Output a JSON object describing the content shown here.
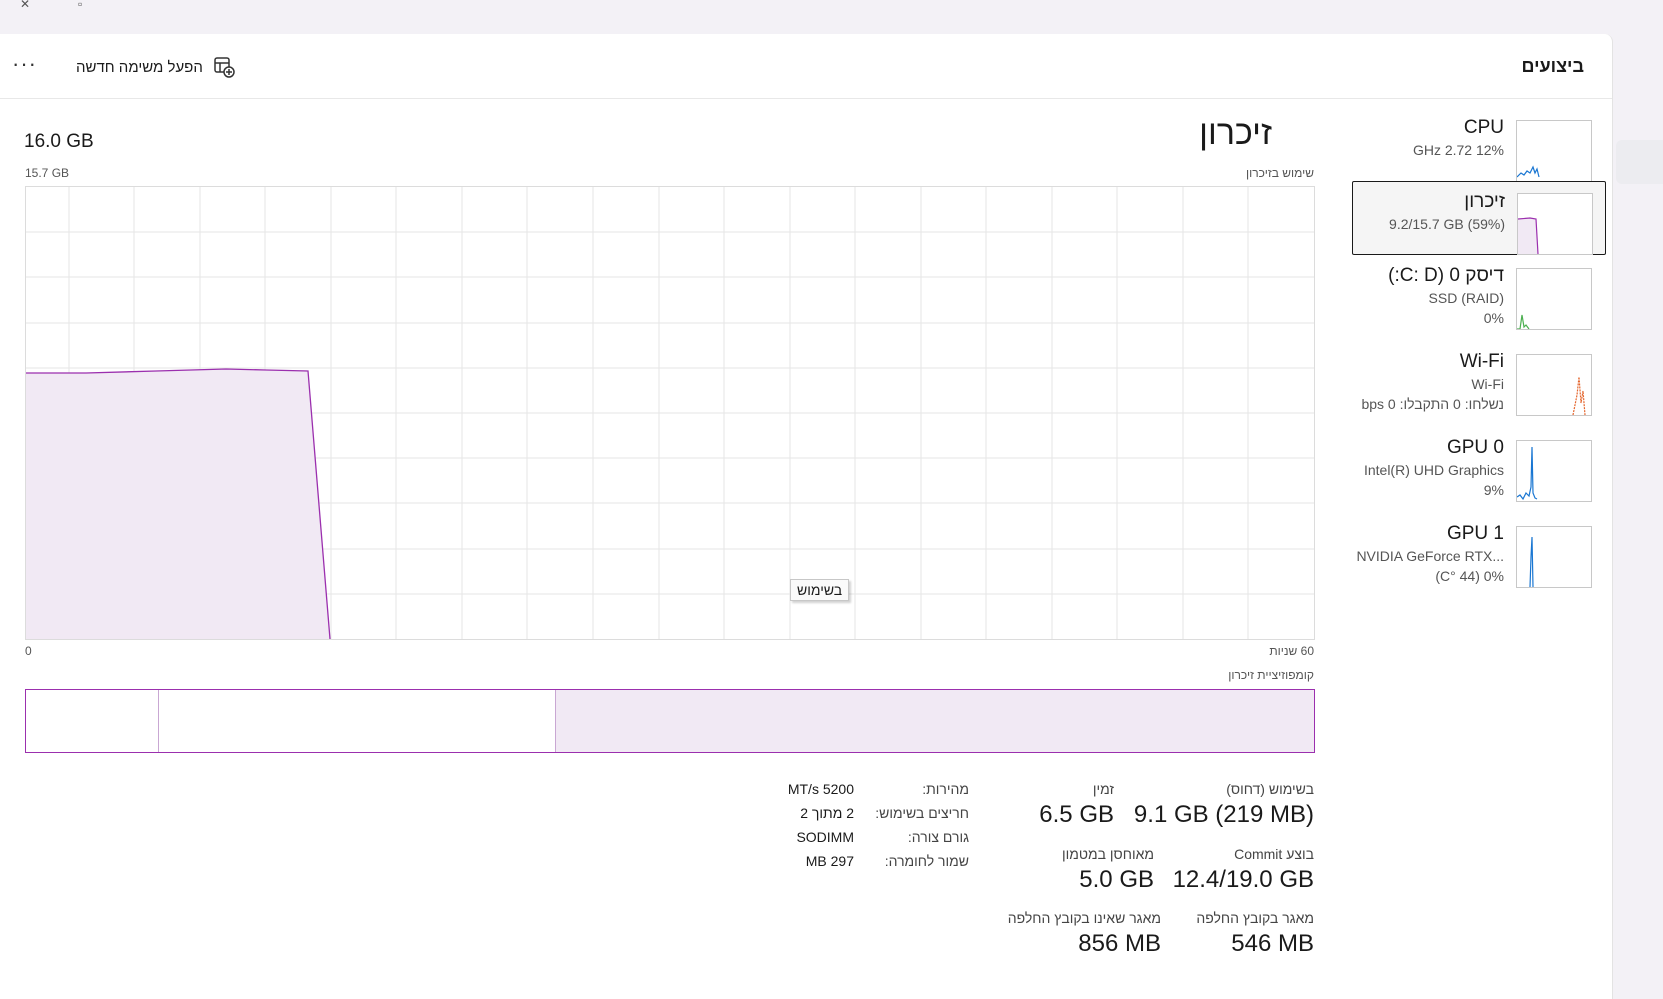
{
  "toolbar": {
    "more_label": "···",
    "new_task_label": "הפעל משימה חדשה",
    "section_title": "ביצועים"
  },
  "sidebar": {
    "items": [
      {
        "name": "CPU",
        "sub1": "12%  2.72 GHz",
        "sub2": "",
        "color": "#1976d2"
      },
      {
        "name": "זיכרון",
        "sub1": "9.2/15.7 GB (59%)",
        "sub2": "",
        "color": "#9b2fae"
      },
      {
        "name": "דיסק 0 (C: D:)",
        "sub1": "SSD (RAID)",
        "sub2": "0%",
        "color": "#4caf50"
      },
      {
        "name": "Wi-Fi",
        "sub1": "Wi-Fi",
        "sub2": "נשלחו: 0 התקבלו: 0 bps",
        "color": "#e4652d"
      },
      {
        "name": "GPU 0",
        "sub1": "Intel(R) UHD Graphics",
        "sub2": "9%",
        "color": "#1976d2"
      },
      {
        "name": "GPU 1",
        "sub1": "NVIDIA GeForce RTX...",
        "sub2": "0%  (44 °C)",
        "color": "#1976d2"
      }
    ]
  },
  "main": {
    "title": "זיכרון",
    "total": "16.0 GB",
    "usage_label": "שימוש בזיכרון",
    "max_label": "15.7 GB",
    "time_label": "60 שניות",
    "zero_label": "0",
    "tooltip": "בשימוש",
    "composition_label": "קומפוזיציית זיכרון",
    "graph_color": "#9b2fae",
    "graph_fill": "#f1e9f4"
  },
  "stats": {
    "in_use_label": "בשימוש (דחוס)",
    "in_use_value": "9.1 GB (219 MB)",
    "available_label": "זמין",
    "available_value": "6.5 GB",
    "committed_label": "בוצע Commit",
    "committed_value": "12.4/19.0 GB",
    "cached_label": "מאוחסן במטמון",
    "cached_value": "5.0 GB",
    "paged_label": "מאגר בקובץ החלפה",
    "paged_value": "546 MB",
    "nonpaged_label": "מאגר שאינו בקובץ החלפה",
    "nonpaged_value": "856 MB"
  },
  "details": {
    "speed_label": "מהירות:",
    "speed_value": "5200 MT/s",
    "slots_label": "חריצים בשימוש:",
    "slots_value": "2 מתוך 2",
    "form_label": "גורם צורה:",
    "form_value": "SODIMM",
    "reserved_label": "שמור לחומרה:",
    "reserved_value": "297 MB"
  }
}
